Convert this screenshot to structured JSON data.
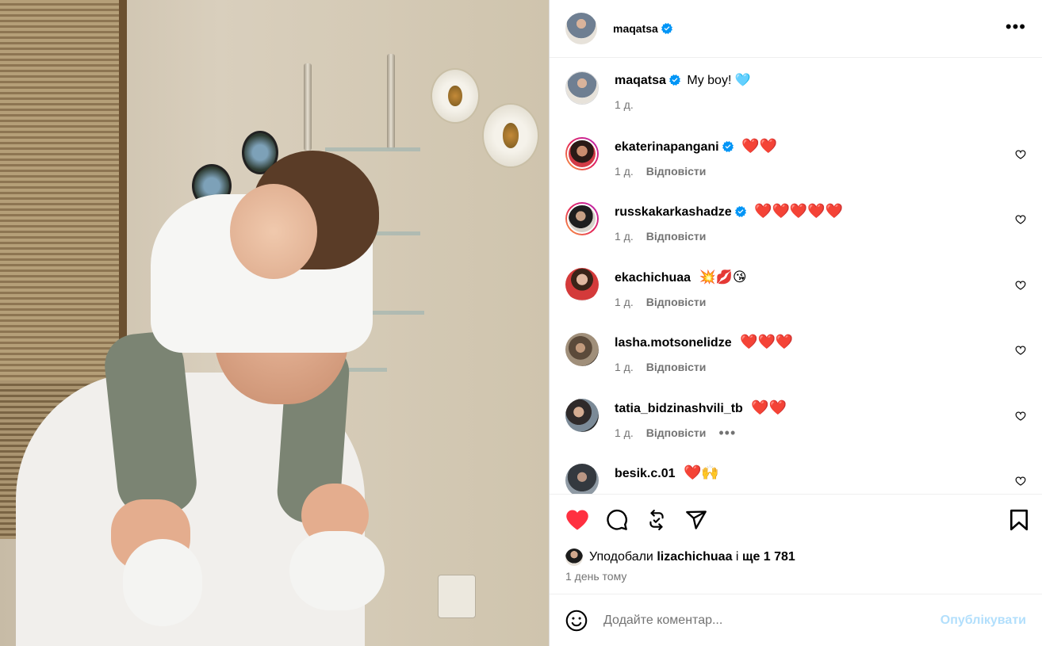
{
  "post": {
    "author": "maqatsa",
    "caption_author": "maqatsa",
    "caption_text": "My boy! 🩵",
    "caption_age": "1 д.",
    "menu_icon": "more-horizontal-icon"
  },
  "comments": [
    {
      "user": "ekaterinapangani",
      "verified": true,
      "text": "❤️❤️",
      "age": "1 д.",
      "reply": "Відповісти",
      "ring": true
    },
    {
      "user": "russkakarkashadze",
      "verified": true,
      "text": "❤️❤️❤️❤️❤️",
      "age": "1 д.",
      "reply": "Відповісти",
      "ring": true
    },
    {
      "user": "ekachichuaa",
      "verified": false,
      "text": "💥💋😘",
      "age": "1 д.",
      "reply": "Відповісти",
      "ring": false
    },
    {
      "user": "lasha.motsonelidze",
      "verified": false,
      "text": "❤️❤️❤️",
      "age": "1 д.",
      "reply": "Відповісти",
      "ring": false
    },
    {
      "user": "tatia_bidzinashvili_tb",
      "verified": false,
      "text": "❤️❤️",
      "age": "1 д.",
      "reply": "Відповісти",
      "ring": false,
      "more": "•••"
    },
    {
      "user": "besik.c.01",
      "verified": false,
      "text": "❤️🙌",
      "age": "",
      "reply": "",
      "ring": false
    }
  ],
  "likes": {
    "prefix": "Уподобали",
    "user": "lizachichuaa",
    "middle": "і",
    "rest": "ще 1 781"
  },
  "date": "1 день тому",
  "add_comment": {
    "placeholder": "Додайте коментар...",
    "post_label": "Опублікувати"
  },
  "colors": {
    "like_active": "#ff3040",
    "verified": "#0095f6",
    "muted": "#737373",
    "post_button": "#b2dffc"
  }
}
